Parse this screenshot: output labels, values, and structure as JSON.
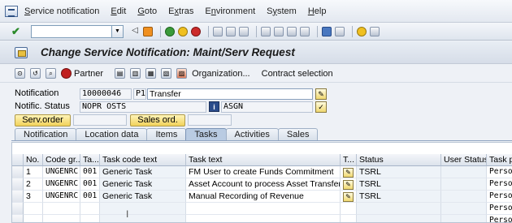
{
  "menu": [
    "Service notification",
    "Edit",
    "Goto",
    "Extras",
    "Environment",
    "System",
    "Help"
  ],
  "menu_underline": [
    "S",
    "E",
    "G",
    "x",
    "n",
    "y",
    "H"
  ],
  "page_title": "Change Service Notification: Maint/Serv Request",
  "app_toolbar": {
    "partner": "Partner",
    "organization": "Organization...",
    "contract": "Contract selection"
  },
  "form": {
    "notification_label": "Notification",
    "notification_number": "10000046",
    "notification_type": "P1",
    "notification_desc": "Transfer",
    "status_label": "Notific. Status",
    "status_value": "NOPR OSTS",
    "user_status": "ASGN",
    "serv_order_btn": "Serv.order",
    "sales_ord_btn": "Sales ord."
  },
  "tabs": [
    "Notification",
    "Location data",
    "Items",
    "Tasks",
    "Activities",
    "Sales"
  ],
  "active_tab": "Tasks",
  "table": {
    "headers": [
      "No.",
      "Code gr...",
      "Ta...",
      "Task code text",
      "Task text",
      "T...",
      "Status",
      "User Status",
      "Task pro"
    ],
    "rows": [
      {
        "no": "1",
        "code_group": "UNGENRC",
        "task": "001",
        "code_text": "Generic Task",
        "task_text": "FM User to create Funds Commitment",
        "status": "TSRL",
        "user_status": "",
        "task_proc": "Person"
      },
      {
        "no": "2",
        "code_group": "UNGENRC",
        "task": "001",
        "code_text": "Generic Task",
        "task_text": "Asset Account to process Asset Transfer",
        "status": "TSRL",
        "user_status": "",
        "task_proc": "Person"
      },
      {
        "no": "3",
        "code_group": "UNGENRC",
        "task": "001",
        "code_text": "Generic Task",
        "task_text": "Manual Recording of Revenue",
        "status": "TSRL",
        "user_status": "",
        "task_proc": "Person"
      }
    ],
    "empty_task_proc": [
      "Person",
      "Person",
      "Person"
    ]
  }
}
